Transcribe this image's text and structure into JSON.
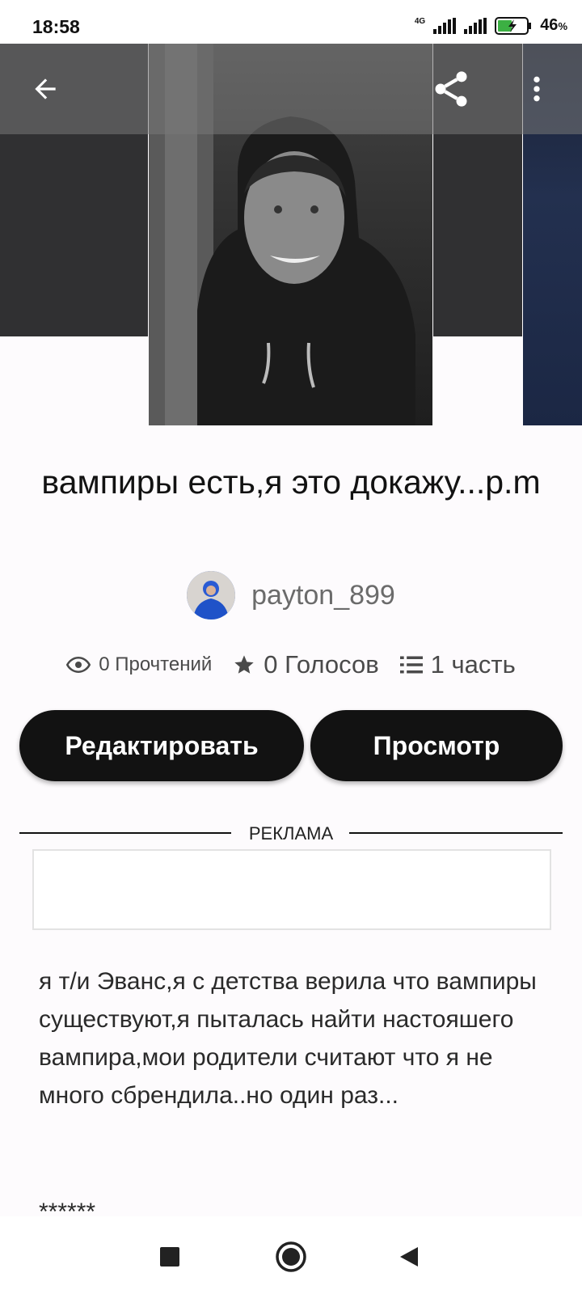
{
  "status_bar": {
    "time": "18:58",
    "network": "4G",
    "battery_percent": "46"
  },
  "appbar": {
    "back_icon": "arrow-left-icon",
    "share_icon": "share-icon",
    "menu_icon": "more-vert-icon"
  },
  "story": {
    "title": "вампиры есть,я это докажу...p.m",
    "author": "payton_899",
    "stats": {
      "reads": "0 Прочтений",
      "votes": "0 Голосов",
      "parts": "1 часть"
    },
    "edit_label": "Редактировать",
    "view_label": "Просмотр",
    "ad_label": "РЕКЛАМА",
    "description": "я т/и Эванс,я с детства верила что вампиры существуют,я пыталась найти настояшего вампира,мои родители считают что я не много сбрендила..но один раз...",
    "separator": "******"
  },
  "navbar": {
    "recents_icon": "square-icon",
    "home_icon": "circle-icon",
    "back_icon": "triangle-back-icon"
  }
}
